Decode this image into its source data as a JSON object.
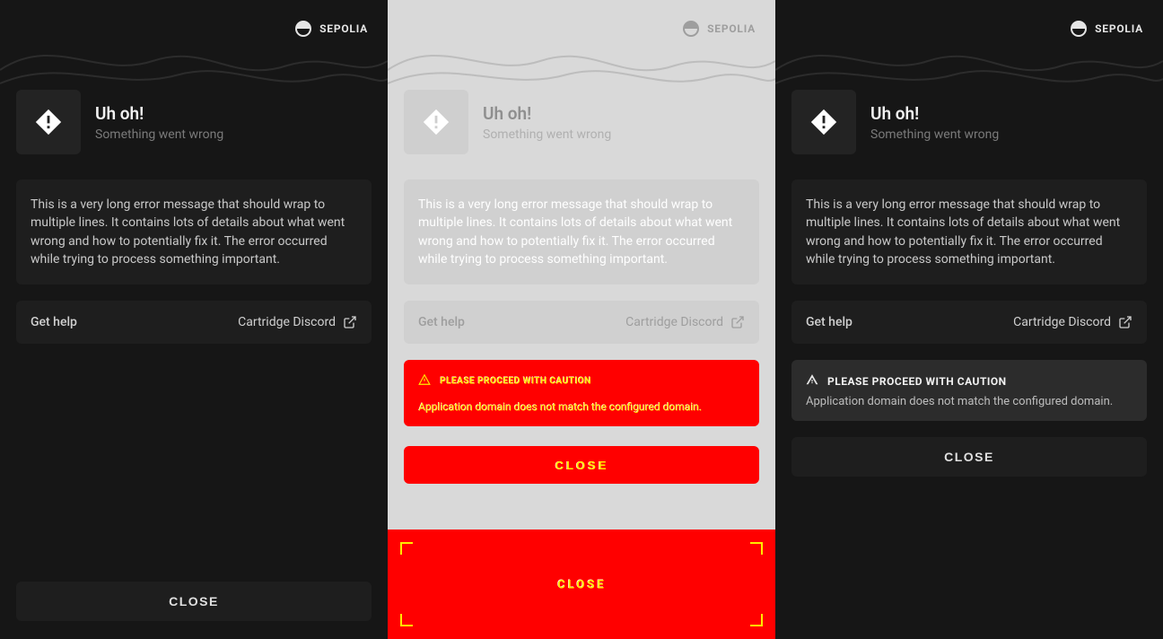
{
  "network": {
    "name": "SEPOLIA"
  },
  "header": {
    "title": "Uh oh!",
    "subtitle": "Something went wrong"
  },
  "error_message": "This is a very long error message that should wrap to multiple lines. It contains lots of details about what went wrong and how to potentially fix it. The error occurred while trying to process something important.",
  "help": {
    "label": "Get help",
    "link_text": "Cartridge Discord"
  },
  "warning": {
    "title": "PLEASE PROCEED WITH CAUTION",
    "description": "Application domain does not match the configured domain."
  },
  "buttons": {
    "close": "CLOSE"
  },
  "diff": {
    "warn_title": "PLEASE PROCEED WITH CAUTION",
    "warn_desc": "Application domain does not match the configured domain.",
    "close": "CLOSE"
  }
}
